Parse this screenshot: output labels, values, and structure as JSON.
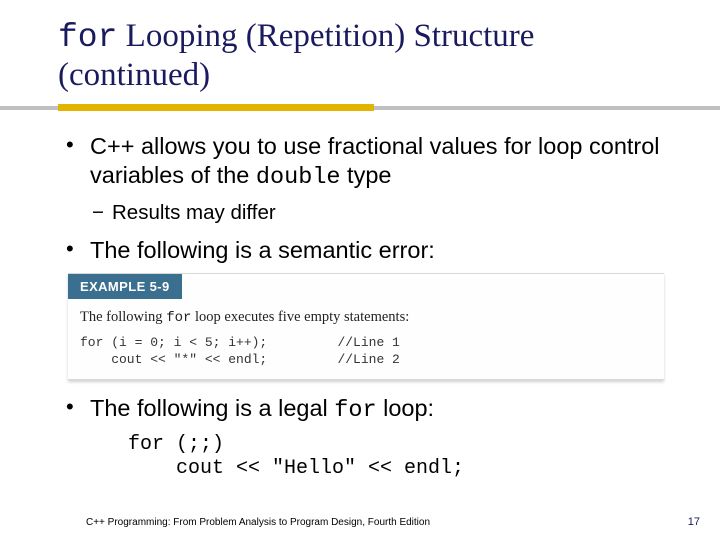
{
  "title": {
    "mono": "for",
    "rest": " Looping (Repetition) Structure (continued)"
  },
  "bullets": {
    "b1a_pre": "C++ allows you to use fractional values for loop control variables of the ",
    "b1a_mono": "double",
    "b1a_post": " type",
    "b2a": "Results may differ",
    "b1b": "The following is a semantic error:",
    "b1c_pre": "The following is a legal ",
    "b1c_mono": "for",
    "b1c_post": " loop:"
  },
  "example": {
    "header": "EXAMPLE 5-9",
    "caption_pre": "The following ",
    "caption_mono": "for",
    "caption_post": " loop executes five empty statements:",
    "code": "for (i = 0; i < 5; i++);         //Line 1\n    cout << \"*\" << endl;         //Line 2"
  },
  "legal_code": "for (;;)\n    cout << \"Hello\" << endl;",
  "footer": {
    "text": "C++ Programming: From Problem Analysis to Program Design, Fourth Edition",
    "page": "17"
  }
}
